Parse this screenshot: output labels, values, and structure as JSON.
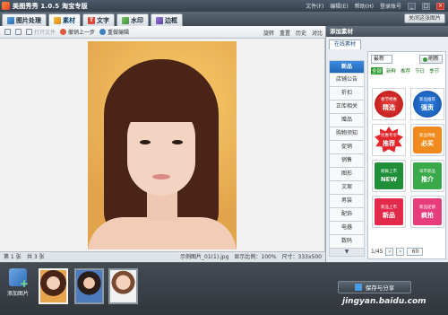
{
  "app": {
    "title": "美图秀秀 1.0.5 淘宝专版"
  },
  "menus": [
    "文件(F)",
    "编辑(E)",
    "帮助(H)",
    "登录账号"
  ],
  "window_controls": [
    "_",
    "□",
    "×"
  ],
  "tabs": [
    {
      "label": "图片处理",
      "icon": "photo-edit-icon"
    },
    {
      "label": "素材",
      "icon": "material-icon"
    },
    {
      "label": "文字",
      "icon": "text-icon"
    },
    {
      "label": "水印",
      "icon": "watermark-icon"
    },
    {
      "label": "边框",
      "icon": "frame-icon"
    }
  ],
  "tabs_right_label": "关闭这张图片",
  "toolbar": {
    "items": [
      "打开文件",
      "撤销上一步",
      "重做编辑"
    ],
    "right_items": [
      "旋转",
      "重置",
      "历史",
      "对比"
    ]
  },
  "panel": {
    "header": "添加素材",
    "tab_label": "在线素材",
    "categories": [
      "新品",
      "店铺公告",
      "折扣",
      "正库相关",
      "赠品",
      "购物须知",
      "促销",
      "销售",
      "图形",
      "文案",
      "男装",
      "配饰",
      "电器",
      "数码"
    ],
    "active_category": "新品",
    "sort_label": "最新",
    "refresh_label": "刷新",
    "filters": [
      "全部",
      "新鲜",
      "推荐",
      "节日",
      "季节"
    ],
    "active_filter": "全部",
    "stickers": [
      {
        "line1": "春节特惠",
        "line2": "精选",
        "style": "b-red-round"
      },
      {
        "line1": "新品推荐",
        "line2": "强贡",
        "style": "b-blue-round"
      },
      {
        "line1": "优惠专享",
        "line2": "推荐",
        "style": "b-red-star"
      },
      {
        "line1": "新品特推",
        "line2": "必买",
        "style": "b-orange"
      },
      {
        "line1": "新鲜上市",
        "line2": "NEW",
        "style": "b-green-square"
      },
      {
        "line1": "早市新品",
        "line2": "推介",
        "style": "b-green-sticker"
      },
      {
        "line1": "新品上市",
        "line2": "新品",
        "style": "b-red-square"
      },
      {
        "line1": "新品促销",
        "line2": "疯抢",
        "style": "b-pink"
      }
    ],
    "page": "1/45",
    "page_size": "60"
  },
  "status": {
    "page_info": "第 1 张",
    "total": "共 3 张",
    "file_name": "示例图片_01(1).jpg",
    "zoom_label": "显示比例：100%",
    "size_label": "尺寸：333x500"
  },
  "bottom": {
    "add_label": "添加图片",
    "save_label": "保存与分享",
    "watermark": "jingyan.baidu.com"
  }
}
